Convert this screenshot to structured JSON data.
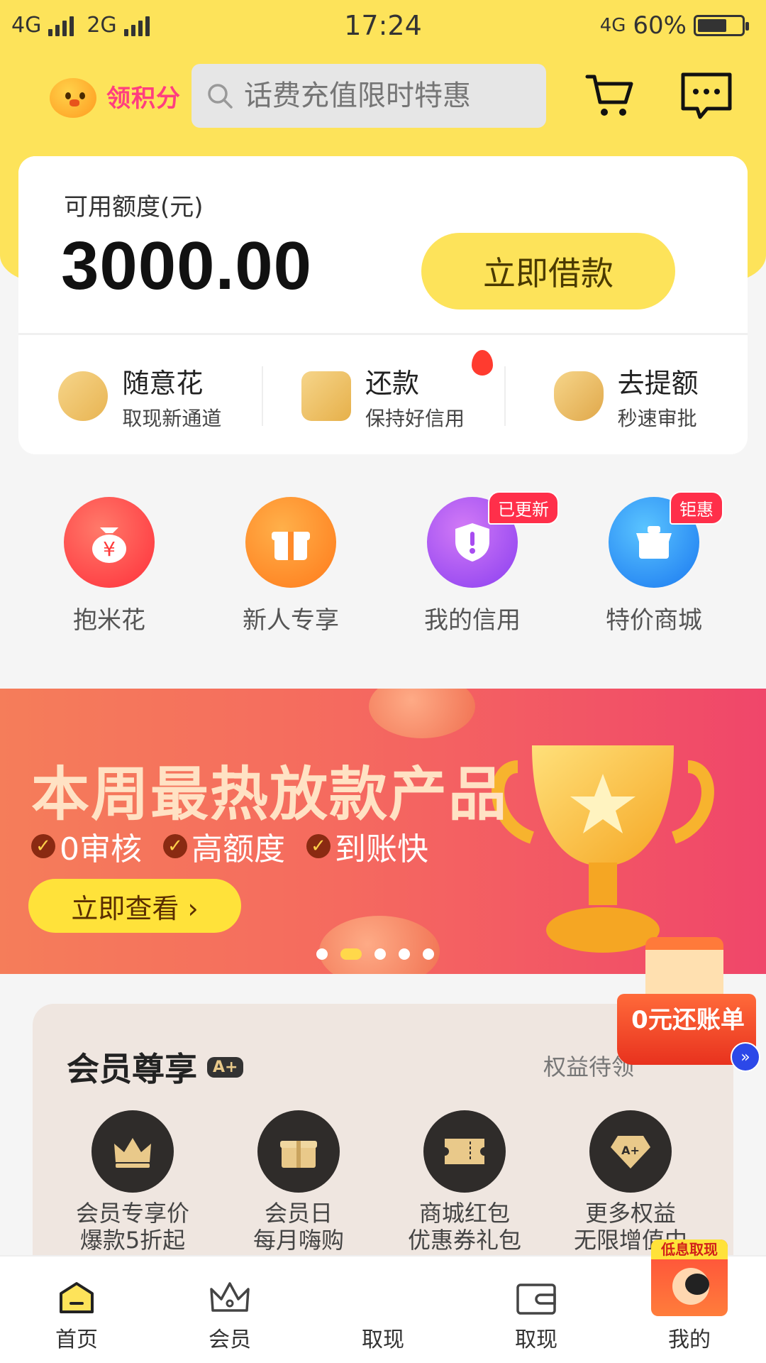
{
  "status_bar": {
    "network1": "4G",
    "network2": "2G",
    "time": "17:24",
    "net_right": "4G",
    "battery": "60%"
  },
  "topbar": {
    "points_label": "领积分",
    "search_placeholder": "话费充值限时特惠"
  },
  "credit": {
    "label": "可用额度(元)",
    "amount": "3000.00",
    "borrow_button": "立即借款"
  },
  "quick_actions": [
    {
      "title": "随意花",
      "subtitle": "取现新通道",
      "icon": "hand-coin-icon"
    },
    {
      "title": "还款",
      "subtitle": "保持好信用",
      "icon": "card-transfer-icon"
    },
    {
      "title": "去提额",
      "subtitle": "秒速审批",
      "icon": "money-bag-icon"
    }
  ],
  "grid": [
    {
      "label": "抱米花",
      "icon": "money-bag-icon",
      "color": "#ff4a4a"
    },
    {
      "label": "新人专享",
      "icon": "gift-icon",
      "color": "#ff8a2a"
    },
    {
      "label": "我的信用",
      "icon": "shield-icon",
      "color": "#b84cf0",
      "badge": "已更新"
    },
    {
      "label": "特价商城",
      "icon": "shop-icon",
      "color": "#2a8ff0",
      "badge": "钜惠"
    }
  ],
  "banner": {
    "title": "本周最热放款产品",
    "features": [
      "0审核",
      "高额度",
      "到账快"
    ],
    "button": "立即查看",
    "page_count": 5,
    "active_index": 1
  },
  "member": {
    "title": "会员尊享",
    "badge": "A+",
    "link": "权益待领",
    "items": [
      {
        "line1": "会员专享价",
        "line2": "爆款5折起",
        "icon": "crown-icon"
      },
      {
        "line1": "会员日",
        "line2": "每月嗨购",
        "icon": "gift-box-icon"
      },
      {
        "line1": "商城红包",
        "line2": "优惠券礼包",
        "icon": "coupon-icon"
      },
      {
        "line1": "更多权益",
        "line2": "无限增值中",
        "icon": "diamond-icon"
      }
    ]
  },
  "float_promo": {
    "text": "0元还账单"
  },
  "bottom_nav": {
    "center_tag": "低息取现",
    "items": [
      {
        "label": "首页",
        "icon": "home-icon"
      },
      {
        "label": "会员",
        "icon": "crown-icon"
      },
      {
        "label": "取现",
        "icon": "promo-image"
      },
      {
        "label": "取现",
        "icon": "wallet-icon"
      },
      {
        "label": "我的",
        "icon": "user-icon"
      }
    ]
  },
  "colors": {
    "brand_yellow": "#fde35a",
    "banner_start": "#f57d5a",
    "banner_end": "#f0466a"
  }
}
